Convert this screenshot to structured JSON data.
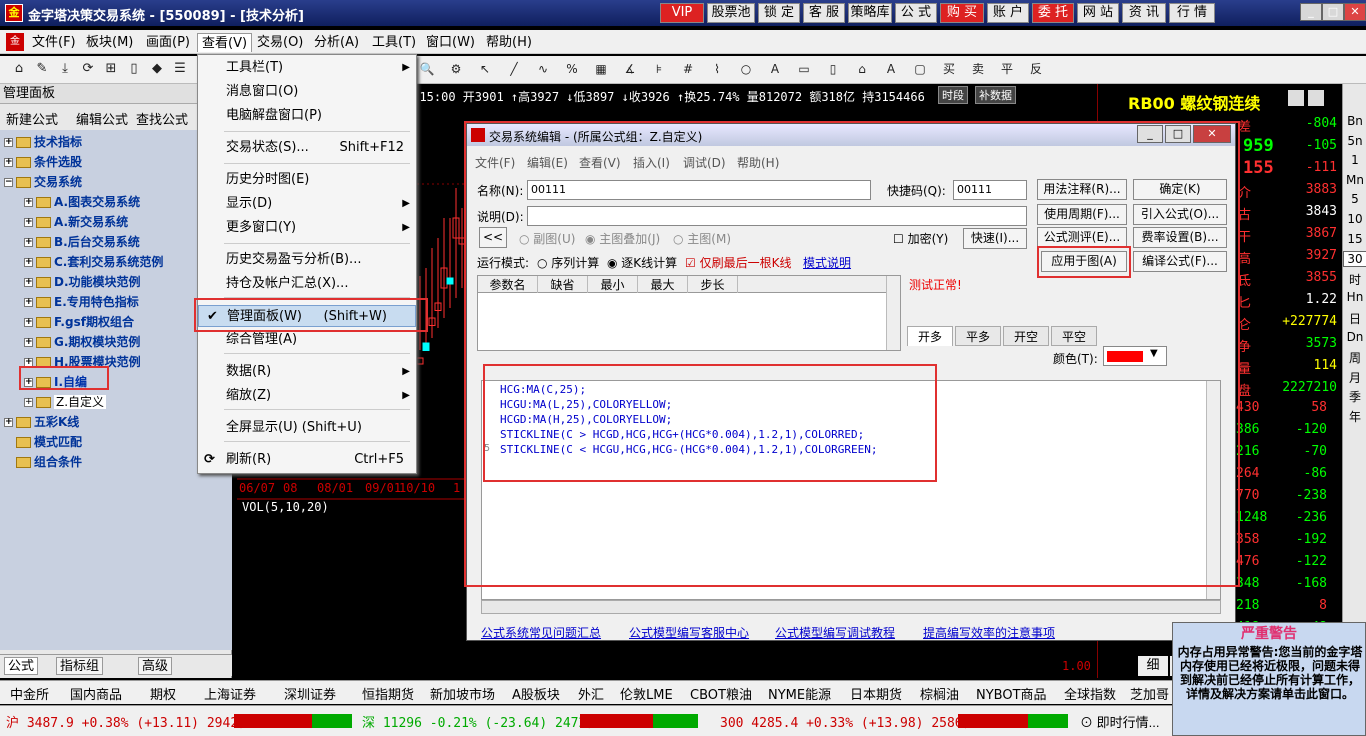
{
  "app": {
    "title": "金字塔决策交易系统 - [550089] - [技术分析]",
    "logo_text": "金",
    "top_buttons": [
      "VIP",
      "股票池",
      "锁 定",
      "客 服",
      "策略库",
      "公 式",
      "购 买",
      "账 户",
      "委 托",
      "网 站",
      "资 讯",
      "行 情"
    ]
  },
  "menubar": [
    "文件(F)",
    "板块(M)",
    "画面(P)",
    "查看(V)",
    "交易(O)",
    "分析(A)",
    "工具(T)",
    "窗口(W)",
    "帮助(H)"
  ],
  "left_panel": {
    "header": "管理面板",
    "actions": [
      "新建公式",
      "编辑公式",
      "查找公式"
    ],
    "tree": [
      {
        "label": "技术指标",
        "level": 0,
        "expander": "+"
      },
      {
        "label": "条件选股",
        "level": 0,
        "expander": "+"
      },
      {
        "label": "交易系统",
        "level": 0,
        "expander": "−"
      },
      {
        "label": "A.图表交易系统",
        "level": 1,
        "expander": "+"
      },
      {
        "label": "A.新交易系统",
        "level": 1,
        "expander": "+"
      },
      {
        "label": "B.后台交易系统",
        "level": 1,
        "expander": "+"
      },
      {
        "label": "C.套利交易系统范例",
        "level": 1,
        "expander": "+"
      },
      {
        "label": "D.功能模块范例",
        "level": 1,
        "expander": "+"
      },
      {
        "label": "E.专用特色指标",
        "level": 1,
        "expander": "+"
      },
      {
        "label": "F.gsf期权组合",
        "level": 1,
        "expander": "+"
      },
      {
        "label": "G.期权模块范例",
        "level": 1,
        "expander": "+"
      },
      {
        "label": "H.股票模块范例",
        "level": 1,
        "expander": "+"
      },
      {
        "label": "I.自编",
        "level": 1,
        "expander": "+"
      },
      {
        "label": "Z.自定义",
        "level": 1,
        "expander": "+"
      },
      {
        "label": "五彩K线",
        "level": 0,
        "expander": "+"
      },
      {
        "label": "模式匹配",
        "level": 0,
        "expander": ""
      },
      {
        "label": "组合条件",
        "level": 0,
        "expander": ""
      }
    ],
    "tabs": [
      "公式",
      "指标组",
      "高级"
    ]
  },
  "chart": {
    "quote_line": "9  15:00  开3901  ↑高3927  ↓低3897  ↓收3926  ↑换25.74%  量812072  额318亿  持3154466",
    "period_buttons": [
      "时段",
      "补数据"
    ],
    "dates": [
      "06/07",
      "08",
      "08/01",
      "09/01",
      "10/10",
      "1"
    ],
    "indicator_label": "VOL(5,10,20)",
    "axis_label": "1.00"
  },
  "view_menu": {
    "items": [
      {
        "label": "工具栏(T)",
        "shortcut": "",
        "submenu": true
      },
      {
        "label": "消息窗口(O)",
        "shortcut": "",
        "submenu": false
      },
      {
        "label": "电脑解盘窗口(P)",
        "shortcut": "",
        "submenu": false
      },
      {
        "label": "交易状态(S)...",
        "shortcut": "Shift+F12",
        "submenu": false
      },
      {
        "label": "历史分时图(E)",
        "shortcut": "",
        "submenu": false
      },
      {
        "label": "显示(D)",
        "shortcut": "",
        "submenu": true
      },
      {
        "label": "更多窗口(Y)",
        "shortcut": "",
        "submenu": true
      },
      {
        "label": "历史交易盈亏分析(B)...",
        "shortcut": "",
        "submenu": false
      },
      {
        "label": "持仓及帐户汇总(X)...",
        "shortcut": "",
        "submenu": false
      },
      {
        "label": "管理面板(W)",
        "shortcut": "(Shift+W)",
        "submenu": false,
        "checked": true
      },
      {
        "label": "综合管理(A)",
        "shortcut": "",
        "submenu": false
      },
      {
        "label": "数据(R)",
        "shortcut": "",
        "submenu": true
      },
      {
        "label": "缩放(Z)",
        "shortcut": "",
        "submenu": true
      },
      {
        "label": "全屏显示(U) (Shift+U)",
        "shortcut": "",
        "submenu": false
      },
      {
        "label": "刷新(R)",
        "shortcut": "Ctrl+F5",
        "submenu": false
      }
    ]
  },
  "dialog": {
    "title": "交易系统编辑 - (所属公式组：Z.自定义)",
    "menu": [
      "文件(F)",
      "编辑(E)",
      "查看(V)",
      "插入(I)",
      "调试(D)",
      "帮助(H)"
    ],
    "name_label": "名称(N):",
    "name_value": "00111",
    "shortcode_label": "快捷码(Q):",
    "shortcode_value": "00111",
    "desc_label": "说明(D):",
    "nav_button": "<<",
    "radio_chart": [
      "副图(U)",
      "主图叠加(J)",
      "主图(M)"
    ],
    "encrypt_label": "加密(Y)",
    "quick_button": "快速(I)...",
    "run_mode_label": "运行模式:",
    "run_modes": [
      "序列计算",
      "逐K线计算"
    ],
    "last_bar_only": "仅刷最后一根K线",
    "mode_help": "模式说明",
    "test_status": "测试正常!",
    "buttons": [
      "用法注释(R)...",
      "确定(K)",
      "使用周期(F)...",
      "引入公式(O)...",
      "公式测评(E)...",
      "费率设置(B)...",
      "应用于图(A)",
      "编译公式(F)..."
    ],
    "param_headers": [
      "参数名",
      "缺省",
      "最小",
      "最大",
      "步长"
    ],
    "trade_tabs": [
      "开多",
      "平多",
      "开空",
      "平空"
    ],
    "color_label": "颜色(T):",
    "color_value": "#ff0000",
    "code_lines": [
      "HCG:MA(C,25);",
      "HCGU:MA(L,25),COLORYELLOW;",
      "HCGD:MA(H,25),COLORYELLOW;",
      "STICKLINE(C > HCGD,HCG,HCG+(HCG*0.004),1.2,1),COLORRED;",
      "STICKLINE(C < HCGU,HCG,HCG-(HCG*0.004),1.2,1),COLORGREEN;"
    ],
    "links": [
      "公式系统常见问题汇总",
      "公式模型编写客服中心",
      "公式模型编写调试教程",
      "提高编写效率的注意事项"
    ]
  },
  "right_panel": {
    "title": "RB00 螺纹钢连续",
    "top_values": [
      {
        "label": "差",
        "value": "-804",
        "color": "#00ff00"
      },
      {
        "label": "",
        "value": "959",
        "value2": "-105",
        "color": "#00ff00"
      },
      {
        "label": "",
        "value": "155",
        "value2": "-111",
        "color": "#ff3030"
      },
      {
        "label": "介",
        "value": "3883",
        "color": "#ff3030"
      },
      {
        "label": "古",
        "value": "3843",
        "color": "#ffffff"
      },
      {
        "label": "干",
        "value": "3867",
        "color": "#ff3030"
      },
      {
        "label": "高",
        "value": "3927",
        "color": "#ff3030"
      },
      {
        "label": "氐",
        "value": "3855",
        "color": "#ff3030"
      },
      {
        "label": "匕",
        "value": "1.22",
        "color": "#ffffff"
      },
      {
        "label": "仑",
        "value": "+227774",
        "color": "#ffff00"
      },
      {
        "label": "争",
        "value": "3573",
        "color": "#00ff00"
      },
      {
        "label": "量",
        "value": "114",
        "color": "#ffff00"
      },
      {
        "label": "盘",
        "value": "2227210",
        "color": "#00ff00"
      }
    ],
    "ticks": [
      {
        "a": "430",
        "b": "58",
        "ca": "#ff3030",
        "cb": "#ff3030"
      },
      {
        "a": "386",
        "b": "-120",
        "ca": "#00ff00",
        "cb": "#00ff00"
      },
      {
        "a": "216",
        "b": "-70",
        "ca": "#00ff00",
        "cb": "#00ff00"
      },
      {
        "a": "264",
        "b": "-86",
        "ca": "#ff3030",
        "cb": "#00ff00"
      },
      {
        "a": "770",
        "b": "-238",
        "ca": "#ff3030",
        "cb": "#00ff00"
      },
      {
        "a": "1248",
        "b": "-236",
        "ca": "#00ff00",
        "cb": "#00ff00"
      },
      {
        "a": "358",
        "b": "-192",
        "ca": "#ff3030",
        "cb": "#00ff00"
      },
      {
        "a": "476",
        "b": "-122",
        "ca": "#ff3030",
        "cb": "#00ff00"
      },
      {
        "a": "348",
        "b": "-168",
        "ca": "#00ff00",
        "cb": "#00ff00"
      },
      {
        "a": "218",
        "b": "8",
        "ca": "#00ff00",
        "cb": "#ff3030"
      },
      {
        "a": "418",
        "b": "-48",
        "ca": "#00ff00",
        "cb": "#00ff00"
      },
      {
        "a": "182",
        "b": "54",
        "ca": "#00ff00",
        "cb": "#ff3030"
      }
    ],
    "bottom_tabs": [
      "细",
      "势"
    ]
  },
  "right_vtabs": [
    "Bn",
    "5n",
    "1",
    "Mn",
    "5",
    "10",
    "15",
    "30",
    "时",
    "Hn",
    "日",
    "Dn",
    "周",
    "月",
    "季",
    "年"
  ],
  "market_bar": [
    "中金所",
    "国内商品",
    "期权",
    "上海证券",
    "深圳证券",
    "恒指期货",
    "新加坡市场",
    "A股板块",
    "外汇",
    "伦敦LME",
    "CBOT粮油",
    "NYME能源",
    "日本期货",
    "棕榈油",
    "NYBOT商品",
    "全球指数",
    "芝加哥"
  ],
  "status_bar": {
    "sh": "沪 3487.9  +0.38% (+13.11) 2942亿",
    "sz": "深 11296 -0.21% (-23.64) 2472亿",
    "hs300": "300 4285.4 +0.33% (+13.98) 2586亿",
    "msg": "即时行情..."
  },
  "warning": {
    "title": "严重警告",
    "text": "内存占用异常警告:您当前的金字塔内存使用已经将近极限，问题未得到解决前已经停止所有计算工作，详情及解决方案请单击此窗口。"
  }
}
